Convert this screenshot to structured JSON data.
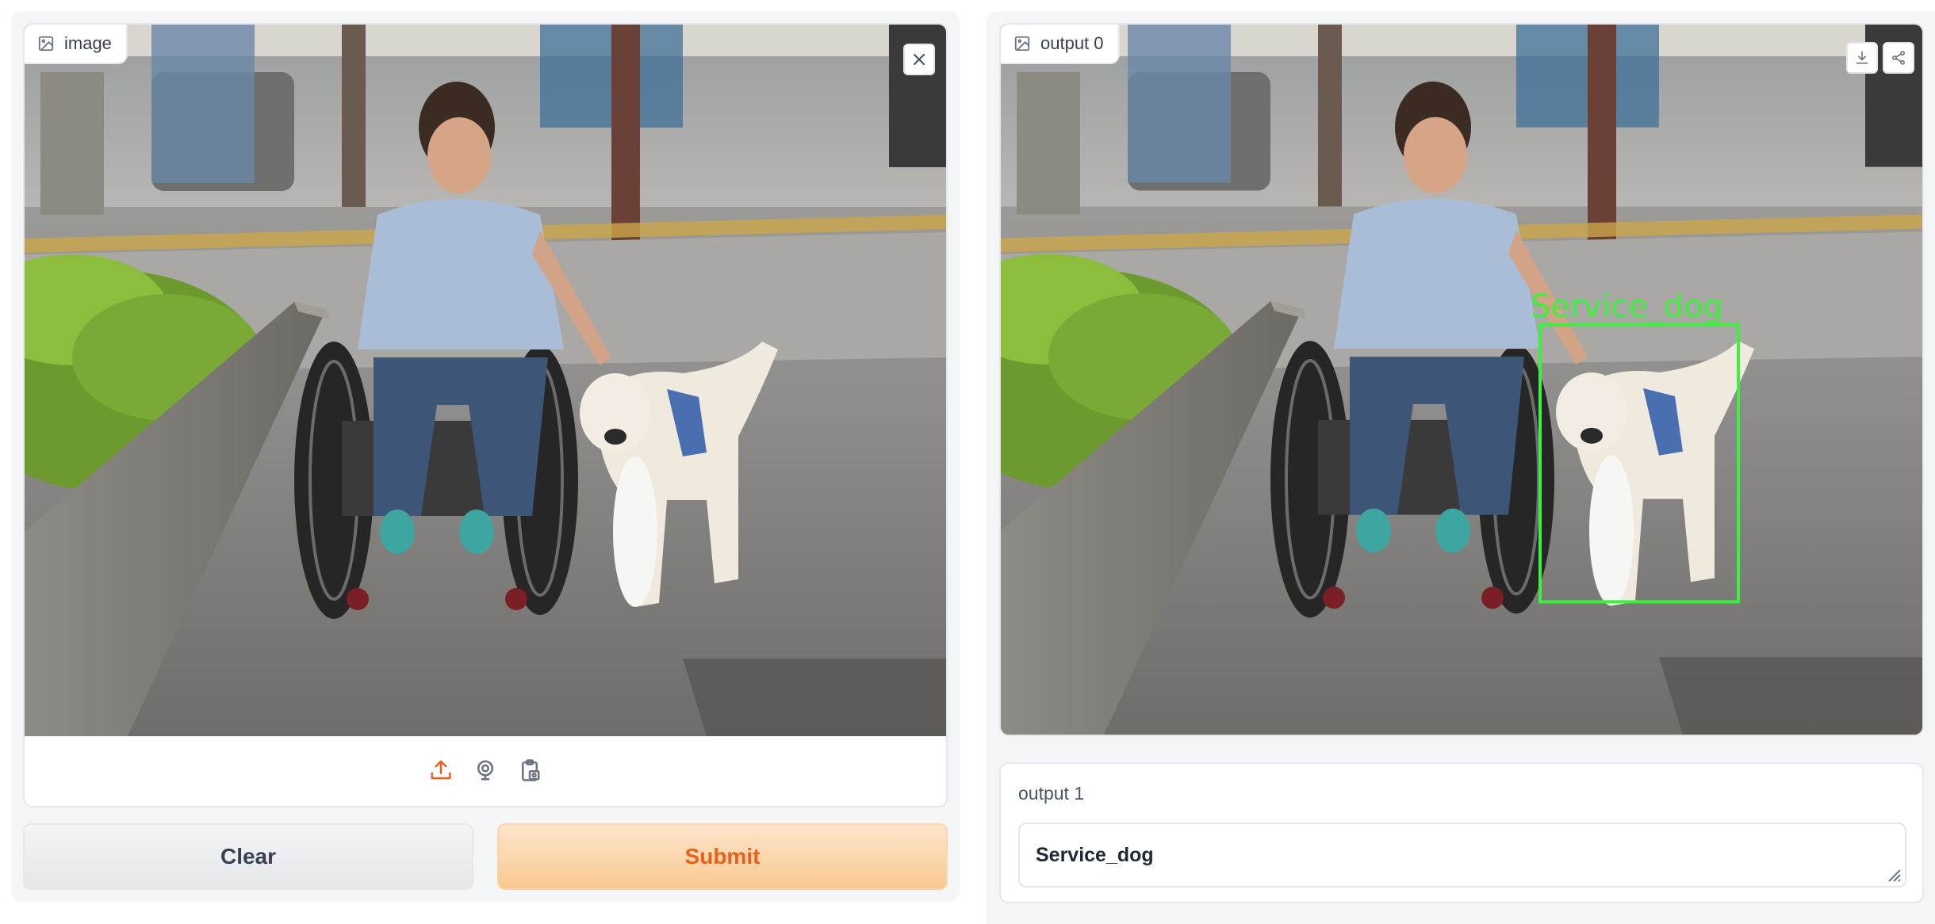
{
  "input_panel": {
    "image_label": "image",
    "close_icon": "close-icon",
    "source_icons": [
      "upload-icon",
      "webcam-icon",
      "clipboard-icon"
    ]
  },
  "actions": {
    "clear_label": "Clear",
    "submit_label": "Submit"
  },
  "output_panel": {
    "image_label": "output 0",
    "detection_label": "Service_dog",
    "tool_icons": [
      "download-icon",
      "share-icon"
    ]
  },
  "text_output": {
    "label": "output 1",
    "value": "Service_dog"
  },
  "colors": {
    "accent": "#e8601c",
    "submit_bg_top": "#fde5cc",
    "submit_bg_bottom": "#f9c98f",
    "bbox": "#3ef03e"
  }
}
